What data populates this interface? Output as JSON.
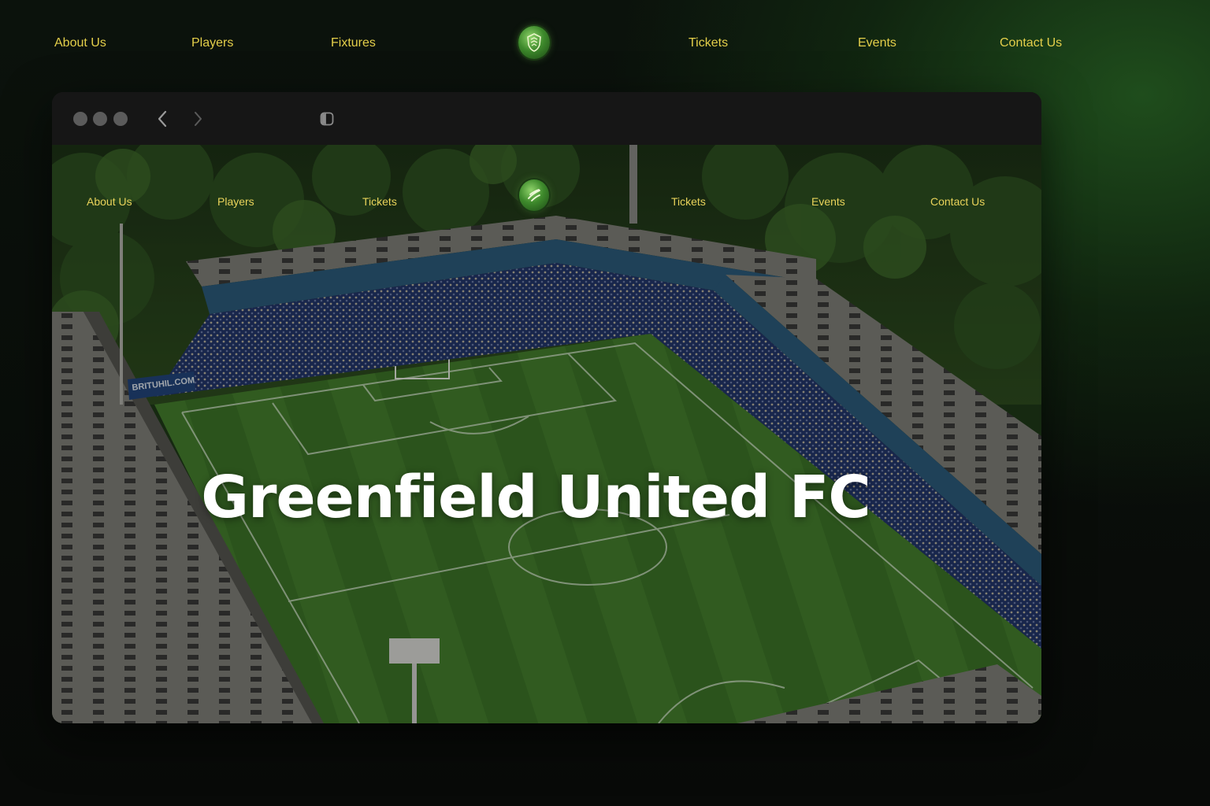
{
  "outer_nav": {
    "items": [
      "About Us",
      "Players",
      "Fixtures",
      "Tickets",
      "Events",
      "Contact Us"
    ],
    "logo_icon": "club-crest-icon"
  },
  "browser": {
    "window_controls": [
      "close",
      "minimize",
      "maximize"
    ],
    "back_icon": "chevron-left-icon",
    "forward_icon": "chevron-right-icon",
    "sidebar_icon": "sidebar-toggle-icon"
  },
  "site": {
    "nav": {
      "items": [
        "About Us",
        "Players",
        "Tickets",
        "Tickets",
        "Events",
        "Contact Us"
      ],
      "logo_icon": "club-crest-icon"
    },
    "hero": {
      "title": "Greenfield United FC",
      "ad_board_text": "BRITUHIL.COM"
    }
  },
  "colors": {
    "nav_text": "#e4cf4a",
    "pitch": "#3f7a2a",
    "stand_roof": "#7e7e78",
    "stand_trim": "#2b5a7a",
    "seats": "#22356a"
  }
}
